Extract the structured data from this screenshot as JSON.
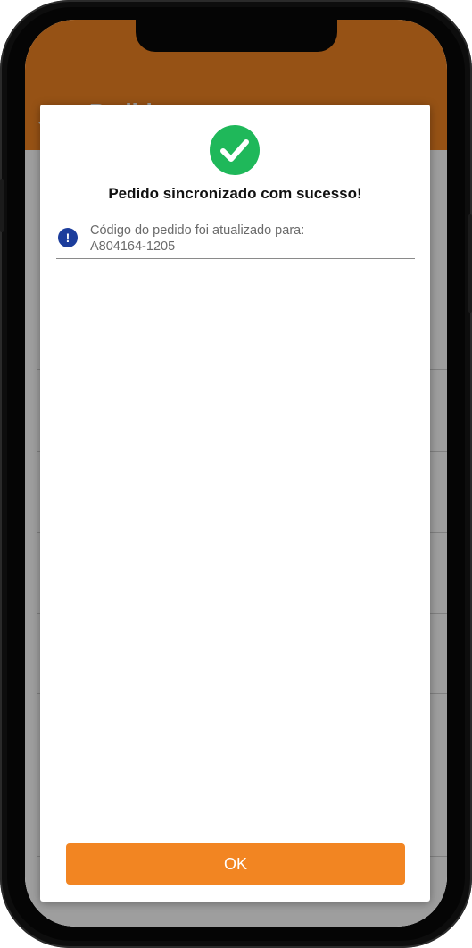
{
  "app": {
    "header_title": "Pedido",
    "back_icon": "arrow-left-icon",
    "accent_color": "#f28522"
  },
  "dialog": {
    "status_icon": "check-circle-icon",
    "status_color": "#1fb85a",
    "title": "Pedido sincronizado com sucesso!",
    "info_icon": "exclamation-circle-icon",
    "info_icon_color": "#1c3d9c",
    "message": "Código do pedido foi atualizado para:",
    "order_code": "A804164-1205",
    "ok_label": "OK"
  }
}
